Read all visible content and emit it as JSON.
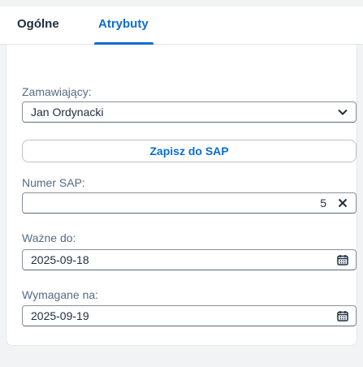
{
  "tabs": [
    {
      "label": "Ogólne",
      "active": false
    },
    {
      "label": "Atrybuty",
      "active": true
    }
  ],
  "form": {
    "orderer": {
      "label": "Zamawiający:",
      "value": "Jan Ordynacki"
    },
    "save_button": {
      "label": "Zapisz do SAP"
    },
    "sap_number": {
      "label": "Numer SAP:",
      "value": "5"
    },
    "valid_until": {
      "label": "Ważne do:",
      "value": "2025-09-18"
    },
    "required_on": {
      "label": "Wymagane na:",
      "value": "2025-09-19"
    }
  },
  "icons": {
    "dropdown": "chevron-down-icon",
    "clear": "close-icon",
    "calendar": "calendar-icon"
  },
  "colors": {
    "accent": "#0a6ed1",
    "text": "#1d2d3e",
    "label": "#556b82",
    "background": "#f2f3f4"
  }
}
